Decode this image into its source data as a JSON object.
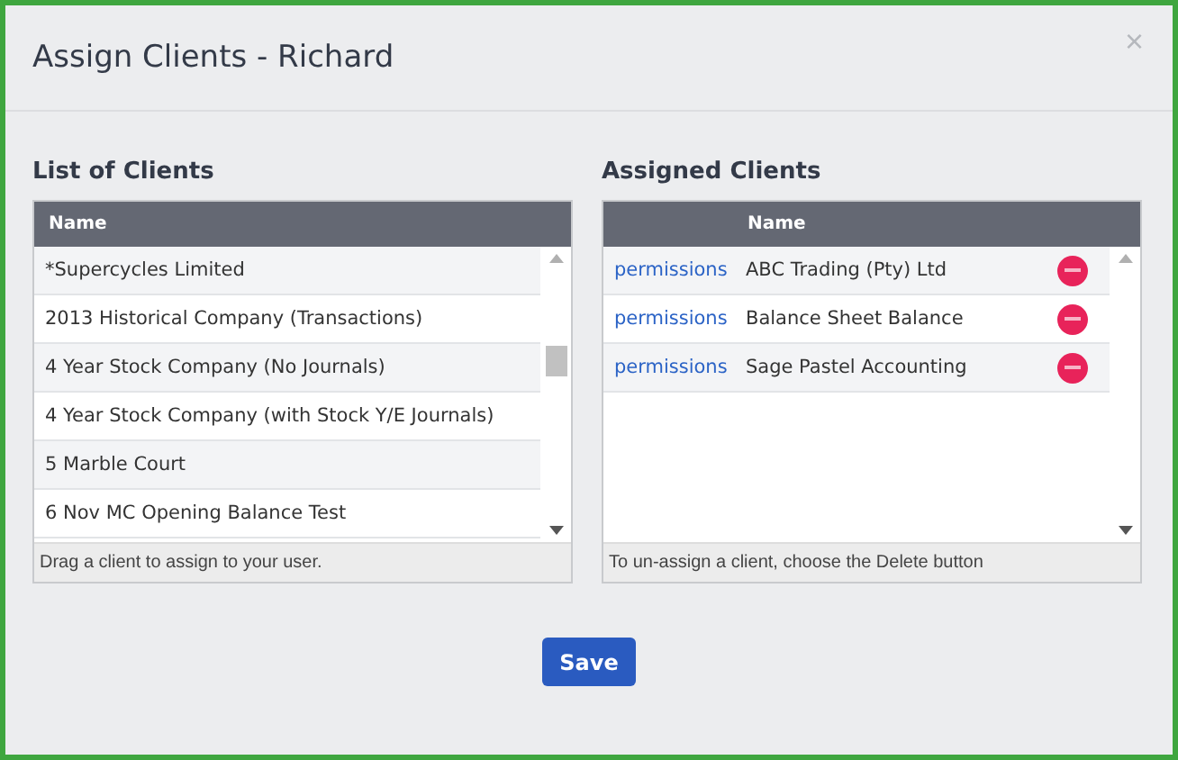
{
  "dialog": {
    "title": "Assign Clients - Richard",
    "close": "×"
  },
  "clients": {
    "heading": "List of Clients",
    "columns": [
      "Name"
    ],
    "rows": [
      {
        "name": "*Supercycles Limited"
      },
      {
        "name": "2013 Historical Company (Transactions)"
      },
      {
        "name": "4 Year Stock Company (No Journals)"
      },
      {
        "name": "4 Year Stock Company (with Stock Y/E Journals)"
      },
      {
        "name": "5 Marble Court"
      },
      {
        "name": "6 Nov MC Opening Balance Test"
      }
    ],
    "hint": "Drag a client to assign to your user."
  },
  "assigned": {
    "heading": "Assigned Clients",
    "columns": [
      "Name"
    ],
    "rows": [
      {
        "link": "permissions",
        "name": "ABC Trading (Pty) Ltd"
      },
      {
        "link": "permissions",
        "name": "Balance Sheet Balance"
      },
      {
        "link": "permissions",
        "name": "Sage Pastel Accounting"
      }
    ],
    "hint": "To un-assign a client, choose the Delete button"
  },
  "buttons": [
    "Save"
  ]
}
